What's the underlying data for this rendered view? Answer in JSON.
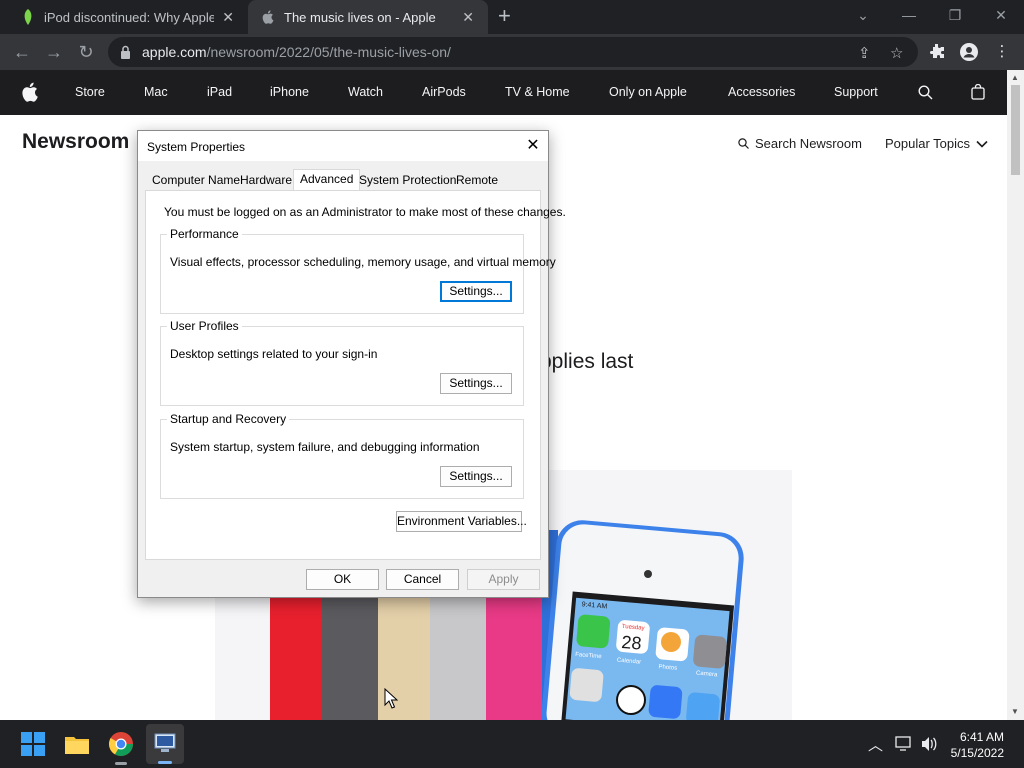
{
  "browser": {
    "tabs": [
      {
        "title": "iPod discontinued: Why Apple is",
        "active": false
      },
      {
        "title": "The music lives on - Apple",
        "active": true
      }
    ],
    "url_host": "apple.com",
    "url_path": "/newsroom/2022/05/the-music-lives-on/"
  },
  "apple_nav": {
    "items": [
      "Store",
      "Mac",
      "iPad",
      "iPhone",
      "Watch",
      "AirPods",
      "TV & Home",
      "Only on Apple",
      "Accessories",
      "Support"
    ]
  },
  "page": {
    "section_title": "Newsroom",
    "search_label": "Search Newsroom",
    "topics_label": "Popular Topics",
    "headline_fragment": "pplies last"
  },
  "dialog": {
    "title": "System Properties",
    "tabs": [
      "Computer Name",
      "Hardware",
      "Advanced",
      "System Protection",
      "Remote"
    ],
    "active_tab": "Advanced",
    "admin_notice": "You must be logged on as an Administrator to make most of these changes.",
    "groups": [
      {
        "label": "Performance",
        "description": "Visual effects, processor scheduling, memory usage, and virtual memory",
        "button": "Settings..."
      },
      {
        "label": "User Profiles",
        "description": "Desktop settings related to your sign-in",
        "button": "Settings..."
      },
      {
        "label": "Startup and Recovery",
        "description": "System startup, system failure, and debugging information",
        "button": "Settings..."
      }
    ],
    "env_button": "Environment Variables...",
    "ok": "OK",
    "cancel": "Cancel",
    "apply": "Apply"
  },
  "hero": {
    "calendar_day": "Tuesday",
    "calendar_date": "28",
    "app_labels": [
      "FaceTime",
      "Calendar",
      "Photos",
      "Camera"
    ],
    "status_time": "9:41 AM"
  },
  "taskbar": {
    "time": "6:41 AM",
    "date": "5/15/2022"
  },
  "colors": {
    "tabstrip": "#202124",
    "toolbar": "#35363a",
    "apple_nav": "#1d1d1f",
    "dialog_bg": "#f0f0f0",
    "focus_blue": "#0078d7"
  }
}
